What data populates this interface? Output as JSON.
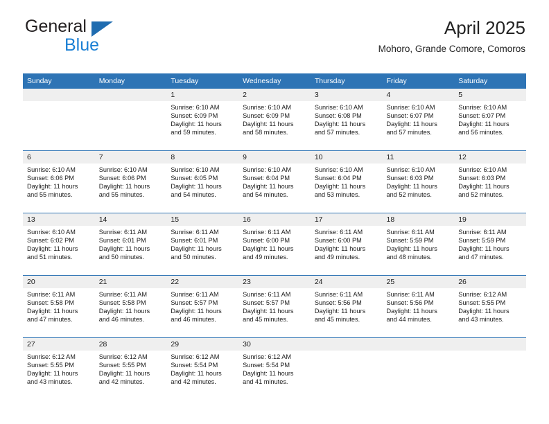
{
  "brand": {
    "name_top": "General",
    "name_bottom": "Blue",
    "color_dark": "#231f20",
    "color_blue": "#1a7fd4",
    "triangle_color": "#1f6cb0"
  },
  "header": {
    "title": "April 2025",
    "subtitle": "Mohoro, Grande Comore, Comoros"
  },
  "theme": {
    "header_bg": "#2e74b5",
    "daynum_bg": "#efefef",
    "row_divider": "#2e74b5"
  },
  "weekday_headers": [
    "Sunday",
    "Monday",
    "Tuesday",
    "Wednesday",
    "Thursday",
    "Friday",
    "Saturday"
  ],
  "weeks": [
    [
      {
        "day": "",
        "sunrise": "",
        "sunset": "",
        "daylight_line1": "",
        "daylight_line2": ""
      },
      {
        "day": "",
        "sunrise": "",
        "sunset": "",
        "daylight_line1": "",
        "daylight_line2": ""
      },
      {
        "day": "1",
        "sunrise": "Sunrise: 6:10 AM",
        "sunset": "Sunset: 6:09 PM",
        "daylight_line1": "Daylight: 11 hours",
        "daylight_line2": "and 59 minutes."
      },
      {
        "day": "2",
        "sunrise": "Sunrise: 6:10 AM",
        "sunset": "Sunset: 6:09 PM",
        "daylight_line1": "Daylight: 11 hours",
        "daylight_line2": "and 58 minutes."
      },
      {
        "day": "3",
        "sunrise": "Sunrise: 6:10 AM",
        "sunset": "Sunset: 6:08 PM",
        "daylight_line1": "Daylight: 11 hours",
        "daylight_line2": "and 57 minutes."
      },
      {
        "day": "4",
        "sunrise": "Sunrise: 6:10 AM",
        "sunset": "Sunset: 6:07 PM",
        "daylight_line1": "Daylight: 11 hours",
        "daylight_line2": "and 57 minutes."
      },
      {
        "day": "5",
        "sunrise": "Sunrise: 6:10 AM",
        "sunset": "Sunset: 6:07 PM",
        "daylight_line1": "Daylight: 11 hours",
        "daylight_line2": "and 56 minutes."
      }
    ],
    [
      {
        "day": "6",
        "sunrise": "Sunrise: 6:10 AM",
        "sunset": "Sunset: 6:06 PM",
        "daylight_line1": "Daylight: 11 hours",
        "daylight_line2": "and 55 minutes."
      },
      {
        "day": "7",
        "sunrise": "Sunrise: 6:10 AM",
        "sunset": "Sunset: 6:06 PM",
        "daylight_line1": "Daylight: 11 hours",
        "daylight_line2": "and 55 minutes."
      },
      {
        "day": "8",
        "sunrise": "Sunrise: 6:10 AM",
        "sunset": "Sunset: 6:05 PM",
        "daylight_line1": "Daylight: 11 hours",
        "daylight_line2": "and 54 minutes."
      },
      {
        "day": "9",
        "sunrise": "Sunrise: 6:10 AM",
        "sunset": "Sunset: 6:04 PM",
        "daylight_line1": "Daylight: 11 hours",
        "daylight_line2": "and 54 minutes."
      },
      {
        "day": "10",
        "sunrise": "Sunrise: 6:10 AM",
        "sunset": "Sunset: 6:04 PM",
        "daylight_line1": "Daylight: 11 hours",
        "daylight_line2": "and 53 minutes."
      },
      {
        "day": "11",
        "sunrise": "Sunrise: 6:10 AM",
        "sunset": "Sunset: 6:03 PM",
        "daylight_line1": "Daylight: 11 hours",
        "daylight_line2": "and 52 minutes."
      },
      {
        "day": "12",
        "sunrise": "Sunrise: 6:10 AM",
        "sunset": "Sunset: 6:03 PM",
        "daylight_line1": "Daylight: 11 hours",
        "daylight_line2": "and 52 minutes."
      }
    ],
    [
      {
        "day": "13",
        "sunrise": "Sunrise: 6:10 AM",
        "sunset": "Sunset: 6:02 PM",
        "daylight_line1": "Daylight: 11 hours",
        "daylight_line2": "and 51 minutes."
      },
      {
        "day": "14",
        "sunrise": "Sunrise: 6:11 AM",
        "sunset": "Sunset: 6:01 PM",
        "daylight_line1": "Daylight: 11 hours",
        "daylight_line2": "and 50 minutes."
      },
      {
        "day": "15",
        "sunrise": "Sunrise: 6:11 AM",
        "sunset": "Sunset: 6:01 PM",
        "daylight_line1": "Daylight: 11 hours",
        "daylight_line2": "and 50 minutes."
      },
      {
        "day": "16",
        "sunrise": "Sunrise: 6:11 AM",
        "sunset": "Sunset: 6:00 PM",
        "daylight_line1": "Daylight: 11 hours",
        "daylight_line2": "and 49 minutes."
      },
      {
        "day": "17",
        "sunrise": "Sunrise: 6:11 AM",
        "sunset": "Sunset: 6:00 PM",
        "daylight_line1": "Daylight: 11 hours",
        "daylight_line2": "and 49 minutes."
      },
      {
        "day": "18",
        "sunrise": "Sunrise: 6:11 AM",
        "sunset": "Sunset: 5:59 PM",
        "daylight_line1": "Daylight: 11 hours",
        "daylight_line2": "and 48 minutes."
      },
      {
        "day": "19",
        "sunrise": "Sunrise: 6:11 AM",
        "sunset": "Sunset: 5:59 PM",
        "daylight_line1": "Daylight: 11 hours",
        "daylight_line2": "and 47 minutes."
      }
    ],
    [
      {
        "day": "20",
        "sunrise": "Sunrise: 6:11 AM",
        "sunset": "Sunset: 5:58 PM",
        "daylight_line1": "Daylight: 11 hours",
        "daylight_line2": "and 47 minutes."
      },
      {
        "day": "21",
        "sunrise": "Sunrise: 6:11 AM",
        "sunset": "Sunset: 5:58 PM",
        "daylight_line1": "Daylight: 11 hours",
        "daylight_line2": "and 46 minutes."
      },
      {
        "day": "22",
        "sunrise": "Sunrise: 6:11 AM",
        "sunset": "Sunset: 5:57 PM",
        "daylight_line1": "Daylight: 11 hours",
        "daylight_line2": "and 46 minutes."
      },
      {
        "day": "23",
        "sunrise": "Sunrise: 6:11 AM",
        "sunset": "Sunset: 5:57 PM",
        "daylight_line1": "Daylight: 11 hours",
        "daylight_line2": "and 45 minutes."
      },
      {
        "day": "24",
        "sunrise": "Sunrise: 6:11 AM",
        "sunset": "Sunset: 5:56 PM",
        "daylight_line1": "Daylight: 11 hours",
        "daylight_line2": "and 45 minutes."
      },
      {
        "day": "25",
        "sunrise": "Sunrise: 6:11 AM",
        "sunset": "Sunset: 5:56 PM",
        "daylight_line1": "Daylight: 11 hours",
        "daylight_line2": "and 44 minutes."
      },
      {
        "day": "26",
        "sunrise": "Sunrise: 6:12 AM",
        "sunset": "Sunset: 5:55 PM",
        "daylight_line1": "Daylight: 11 hours",
        "daylight_line2": "and 43 minutes."
      }
    ],
    [
      {
        "day": "27",
        "sunrise": "Sunrise: 6:12 AM",
        "sunset": "Sunset: 5:55 PM",
        "daylight_line1": "Daylight: 11 hours",
        "daylight_line2": "and 43 minutes."
      },
      {
        "day": "28",
        "sunrise": "Sunrise: 6:12 AM",
        "sunset": "Sunset: 5:55 PM",
        "daylight_line1": "Daylight: 11 hours",
        "daylight_line2": "and 42 minutes."
      },
      {
        "day": "29",
        "sunrise": "Sunrise: 6:12 AM",
        "sunset": "Sunset: 5:54 PM",
        "daylight_line1": "Daylight: 11 hours",
        "daylight_line2": "and 42 minutes."
      },
      {
        "day": "30",
        "sunrise": "Sunrise: 6:12 AM",
        "sunset": "Sunset: 5:54 PM",
        "daylight_line1": "Daylight: 11 hours",
        "daylight_line2": "and 41 minutes."
      },
      {
        "day": "",
        "sunrise": "",
        "sunset": "",
        "daylight_line1": "",
        "daylight_line2": ""
      },
      {
        "day": "",
        "sunrise": "",
        "sunset": "",
        "daylight_line1": "",
        "daylight_line2": ""
      },
      {
        "day": "",
        "sunrise": "",
        "sunset": "",
        "daylight_line1": "",
        "daylight_line2": ""
      }
    ]
  ]
}
